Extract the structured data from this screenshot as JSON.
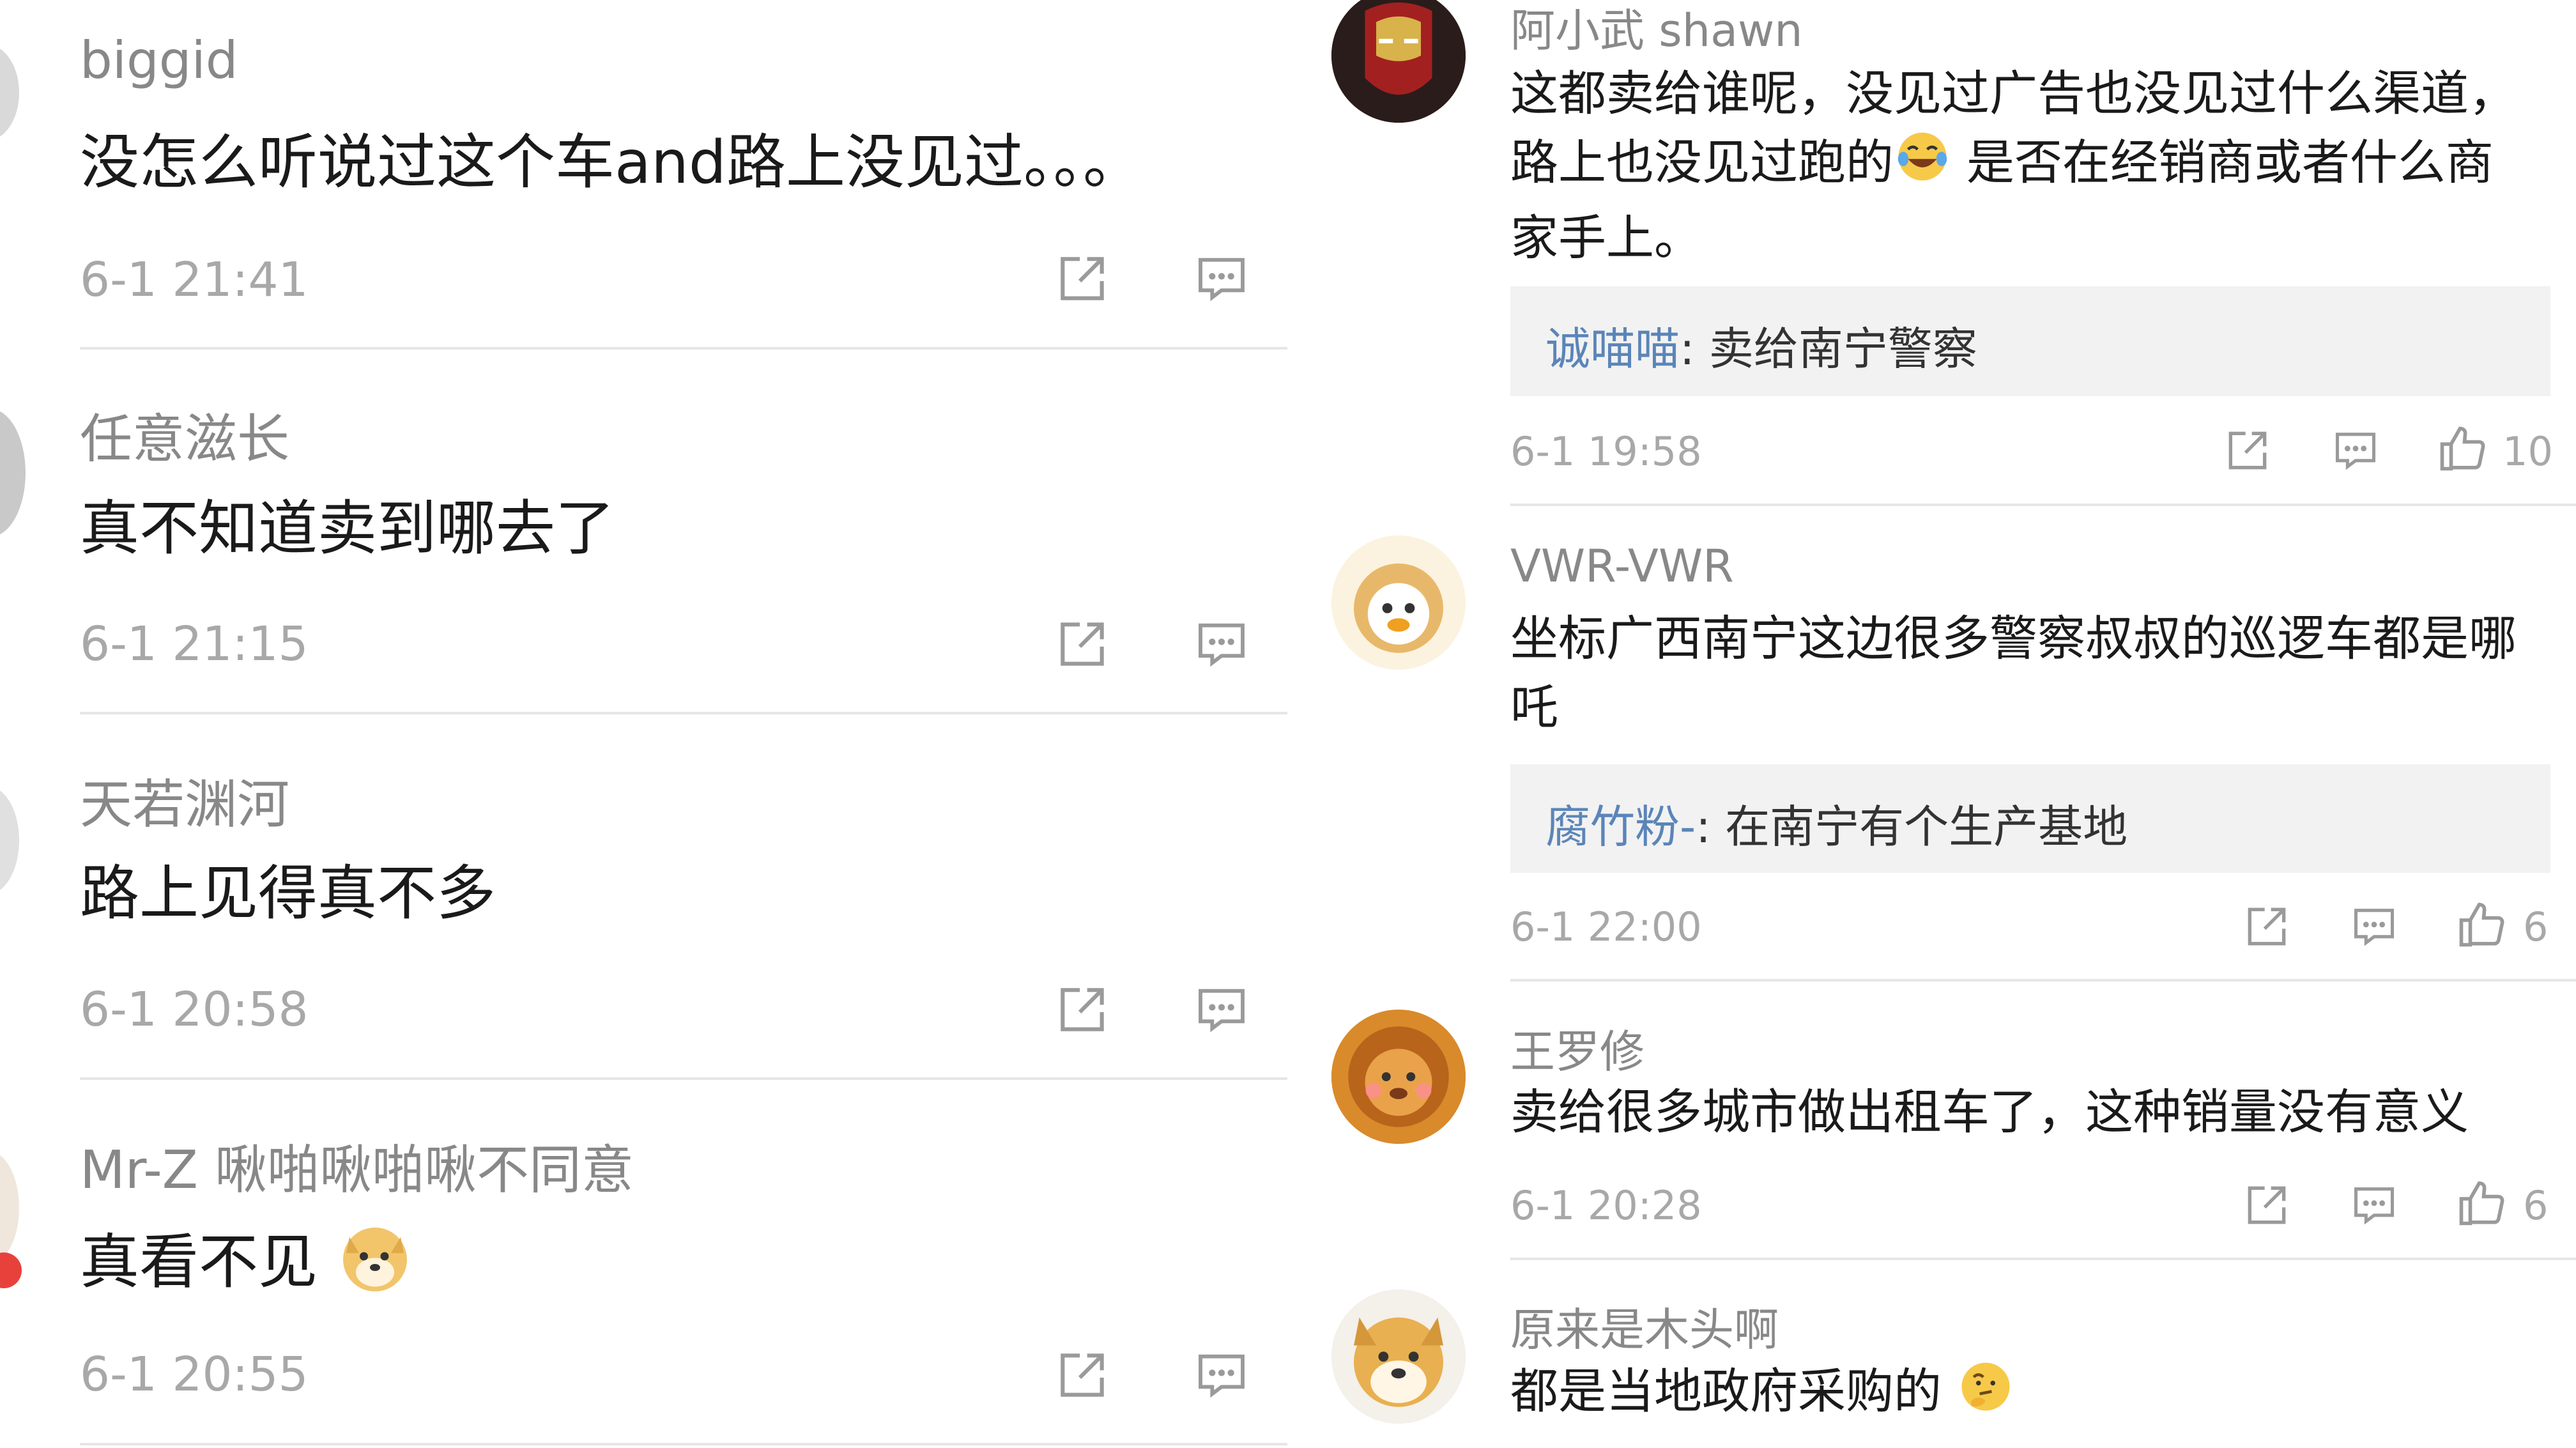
{
  "left_comments": [
    {
      "user": "biggid",
      "text": "没怎么听说过这个车and路上没见过。。。",
      "time": "6-1 21:41"
    },
    {
      "user": "任意滋长",
      "text": "真不知道卖到哪去了",
      "time": "6-1 21:15"
    },
    {
      "user": "天若渊河",
      "text": "路上见得真不多",
      "time": "6-1 20:58"
    },
    {
      "user": "Mr-Z 啾啪啾啪啾不同意",
      "text": "真看不见",
      "time": "6-1 20:55"
    }
  ],
  "right_comments": [
    {
      "user": "阿小武 shawn",
      "text_lines": [
        "这都卖给谁呢，没见过广告也没见过什么渠道，",
        "路上也没见过跑的",
        " 是否在经销商或者什么商",
        "家手上。"
      ],
      "reply_user": "诚喵喵",
      "reply_text": ": 卖给南宁警察",
      "time": "6-1 19:58",
      "likes": "10"
    },
    {
      "user": "VWR-VWR",
      "text_lines": [
        "坐标广西南宁这边很多警察叔叔的巡逻车都是哪",
        "吒"
      ],
      "reply_user": "腐竹粉-",
      "reply_text": ": 在南宁有个生产基地",
      "time": "6-1 22:00",
      "likes": "6"
    },
    {
      "user": "王罗修",
      "text": "卖给很多城市做出租车了，这种销量没有意义",
      "time": "6-1 20:28",
      "likes": "6"
    },
    {
      "user": "原来是木头啊",
      "text": "都是当地政府采购的"
    }
  ],
  "colors": {
    "username": "#888888",
    "time": "#a8a8a8",
    "reply_user": "#5b85b8",
    "reply_bg": "#f2f2f2",
    "divider": "#e6e6e6"
  },
  "icons": [
    "share-icon",
    "comment-icon",
    "like-icon",
    "doge-emoji",
    "crying-laugh-emoji",
    "thinking-emoji"
  ]
}
